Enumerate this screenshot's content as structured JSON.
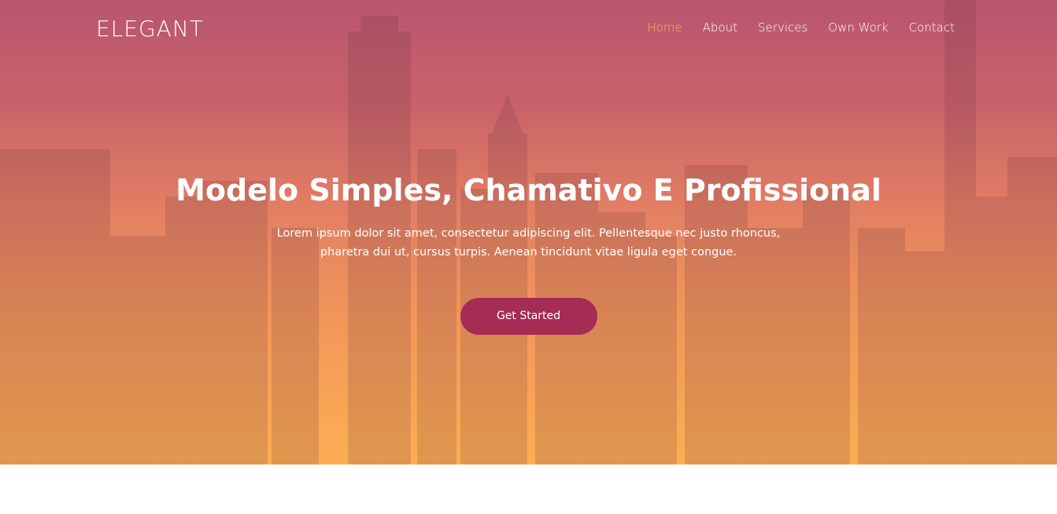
{
  "brand": {
    "logo_text": "ELEGANT"
  },
  "nav": {
    "items": [
      {
        "label": "Home",
        "active": true
      },
      {
        "label": "About",
        "active": false
      },
      {
        "label": "Services",
        "active": false
      },
      {
        "label": "Own Work",
        "active": false
      },
      {
        "label": "Contact",
        "active": false
      }
    ]
  },
  "hero": {
    "title": "Modelo Simples, Chamativo E Profissional",
    "text_line1": "Lorem ipsum dolor sit amet, consectetur adipiscing elit. Pellentesque nec justo rhoncus,",
    "text_line2": "pharetra dui ut, cursus turpis. Aenean tincidunt vitae ligula eget congue.",
    "cta_label": "Get Started"
  },
  "colors": {
    "gradient_top": "#b9566f",
    "gradient_bottom": "#fcae52",
    "nav_active": "#ffb15c",
    "cta_bg": "#a52c55",
    "text": "#ffffff"
  }
}
